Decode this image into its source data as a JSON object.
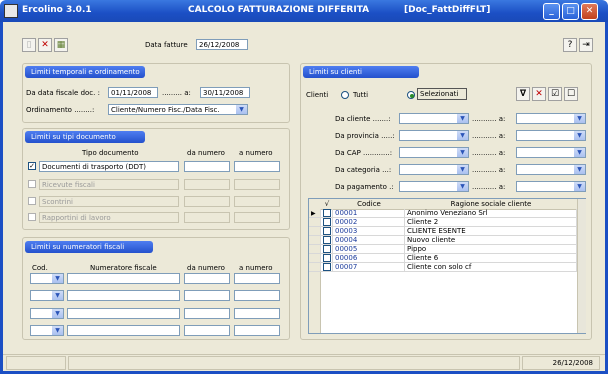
{
  "window": {
    "app_title": "Ercolino 3.0.1",
    "form_title": "CALCOLO FATTURAZIONE DIFFERITA",
    "form_code": "[Doc_FattDiffFLT]"
  },
  "toolbar": {
    "data_fatture_label": "Data fatture",
    "data_fatture_value": "26/12/2008"
  },
  "limiti_temporali": {
    "title": "Limiti temporali e ordinamento",
    "da_data_label": "Da data fiscale doc. :",
    "da_data_value": "01/11/2008",
    "a_label": "......... a:",
    "a_value": "30/11/2008",
    "ordinamento_label": "Ordinamento ........:",
    "ordinamento_value": "Cliente/Numero Fisc./Data Fisc."
  },
  "limiti_tipi": {
    "title": "Limiti su tipi documento",
    "col_tipo": "Tipo documento",
    "col_da": "da numero",
    "col_a": "a numero",
    "rows": [
      {
        "checked": true,
        "label": "Documenti di trasporto (DDT)",
        "enabled": true
      },
      {
        "checked": false,
        "label": "Ricevute fiscali",
        "enabled": false
      },
      {
        "checked": false,
        "label": "Scontrini",
        "enabled": false
      },
      {
        "checked": false,
        "label": "Rapportini di lavoro",
        "enabled": false
      }
    ]
  },
  "limiti_numeratori": {
    "title": "Limiti su numeratori fiscali",
    "col_cod": "Cod.",
    "col_num": "Numeratore fiscale",
    "col_da": "da numero",
    "col_a": "a numero"
  },
  "limiti_clienti": {
    "title": "Limiti su clienti",
    "clienti_label": "Clienti",
    "radio_tutti": "Tutti",
    "radio_selezionati": "Selezionati",
    "range_a_label": "........... a:",
    "filters": [
      {
        "label": "Da cliente .......:"
      },
      {
        "label": "Da provincia .....:"
      },
      {
        "label": "Da CAP ............:"
      },
      {
        "label": "Da categoria ...:"
      },
      {
        "label": "Da pagamento .:"
      }
    ],
    "grid": {
      "col_check": "√",
      "col_codice": "Codice",
      "col_ragione": "Ragione sociale cliente",
      "rows": [
        {
          "codice": "00001",
          "ragione": "Anonimo Veneziano Srl"
        },
        {
          "codice": "00002",
          "ragione": "Cliente 2"
        },
        {
          "codice": "00003",
          "ragione": "CLIENTE ESENTE"
        },
        {
          "codice": "00004",
          "ragione": "Nuovo cliente"
        },
        {
          "codice": "00005",
          "ragione": "Pippo"
        },
        {
          "codice": "00006",
          "ragione": "Cliente 6"
        },
        {
          "codice": "00007",
          "ragione": "Cliente con solo cf"
        }
      ]
    }
  },
  "status": {
    "date": "26/12/2008"
  },
  "colors": {
    "title_bar": "#1b4fc4",
    "panel_header": "#2451cc",
    "window_face": "#ece9d8"
  }
}
